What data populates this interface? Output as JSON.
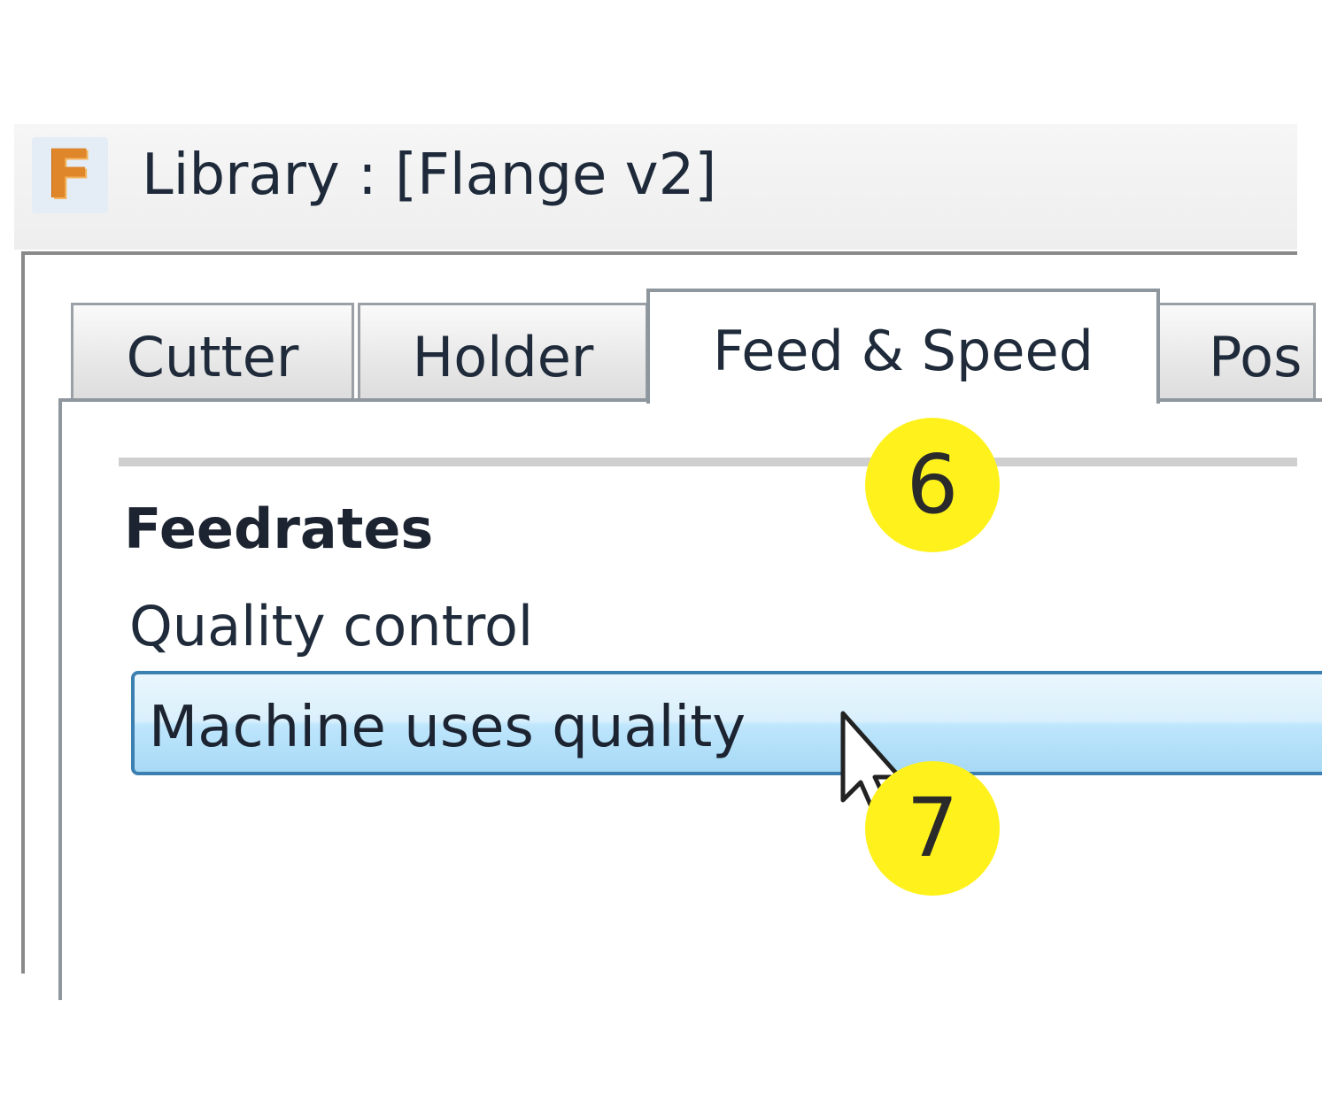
{
  "window": {
    "title": "Library :  [Flange v2]",
    "app_icon_letter": "F",
    "app_icon_name": "fusion-app-icon"
  },
  "tabs": [
    {
      "label": "Cutter",
      "selected": false
    },
    {
      "label": "Holder",
      "selected": false
    },
    {
      "label": "Feed & Speed",
      "selected": true
    },
    {
      "label": "Pos",
      "selected": false
    }
  ],
  "section": {
    "heading": "Feedrates"
  },
  "quality_control": {
    "label": "Quality control",
    "value": "Machine uses quality"
  },
  "callouts": [
    "6",
    "7"
  ],
  "colors": {
    "accent": "#3c7fb1",
    "callout": "#fff21c",
    "combo_highlight": "#bee6fd"
  },
  "cursor_icon": "mouse-pointer-icon"
}
